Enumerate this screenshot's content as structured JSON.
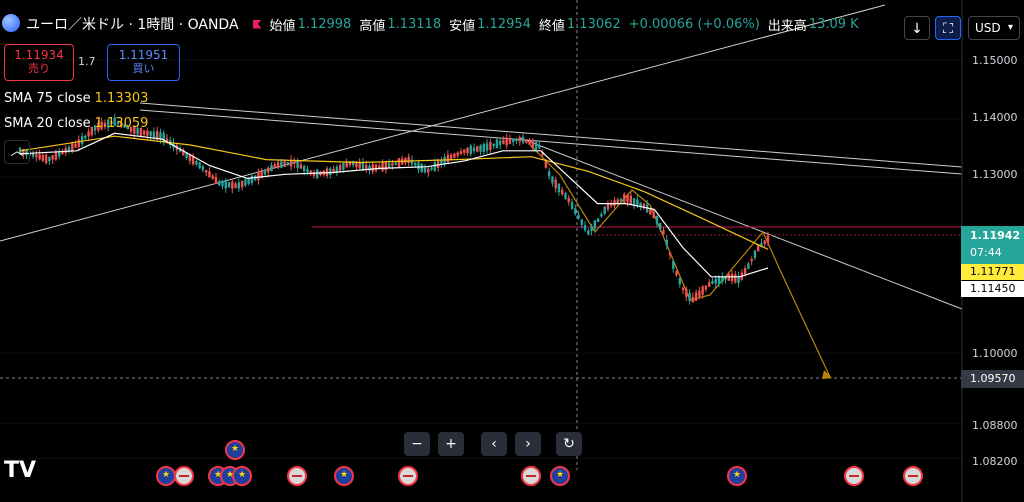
{
  "header": {
    "symbol": "ユーロ／米ドル · 1時間 · OANDA",
    "open_label": "始値",
    "open": "1.12998",
    "high_label": "高値",
    "high": "1.13118",
    "low_label": "安値",
    "low": "1.12954",
    "close_label": "終値",
    "close": "1.13062",
    "change": "+0.00066 (+0.06%)",
    "volume_label": "出来高",
    "volume": "13.09 K"
  },
  "trade": {
    "sell_price": "1.11934",
    "sell_label": "売り",
    "spread": "1.7",
    "buy_price": "1.11951",
    "buy_label": "買い"
  },
  "indicators": [
    {
      "name": "SMA 75 close",
      "value": "1.13303",
      "color": "#f5c518"
    },
    {
      "name": "SMA 20 close",
      "value": "1.13059",
      "color": "#ffffff"
    }
  ],
  "toolbar": {
    "currency": "USD",
    "download_icon": "arrow-down-icon",
    "fullscreen_icon": "expand-icon"
  },
  "price_tags": {
    "last": "1.11942",
    "countdown": "07:44",
    "sma75": "1.11771",
    "sma20": "1.11450",
    "crosshair": "1.09570"
  },
  "navigation": [
    "zoom-out-icon",
    "zoom-in-icon",
    "scroll-left-icon",
    "scroll-right-icon",
    "reset-icon"
  ],
  "chart_data": {
    "type": "line",
    "y_axis_ticks": [
      "1.15000",
      "1.14000",
      "1.13000",
      "1.10000",
      "1.08800",
      "1.08200"
    ],
    "ylim": [
      1.078,
      1.158
    ],
    "candle_trend": [
      [
        0,
        1.1345
      ],
      [
        3,
        1.133
      ],
      [
        6,
        1.1355
      ],
      [
        8,
        1.1385
      ],
      [
        10,
        1.1395
      ],
      [
        12,
        1.138
      ],
      [
        15,
        1.137
      ],
      [
        17,
        1.1345
      ],
      [
        19,
        1.132
      ],
      [
        21,
        1.129
      ],
      [
        23,
        1.1285
      ],
      [
        25,
        1.13
      ],
      [
        27,
        1.132
      ],
      [
        29,
        1.1325
      ],
      [
        31,
        1.1305
      ],
      [
        33,
        1.131
      ],
      [
        35,
        1.1325
      ],
      [
        37,
        1.1315
      ],
      [
        39,
        1.132
      ],
      [
        41,
        1.133
      ],
      [
        43,
        1.131
      ],
      [
        45,
        1.133
      ],
      [
        47,
        1.1345
      ],
      [
        49,
        1.135
      ],
      [
        51,
        1.136
      ],
      [
        53,
        1.1365
      ],
      [
        55,
        1.135
      ],
      [
        56,
        1.13
      ],
      [
        58,
        1.126
      ],
      [
        60,
        1.1205
      ],
      [
        61,
        1.1225
      ],
      [
        62,
        1.125
      ],
      [
        64,
        1.1265
      ],
      [
        66,
        1.125
      ],
      [
        67,
        1.1235
      ],
      [
        68,
        1.1205
      ],
      [
        69,
        1.115
      ],
      [
        70,
        1.111
      ],
      [
        71,
        1.109
      ],
      [
        72,
        1.1105
      ],
      [
        73,
        1.112
      ],
      [
        75,
        1.113
      ],
      [
        76,
        1.1125
      ],
      [
        77,
        1.115
      ],
      [
        78,
        1.118
      ],
      [
        79,
        1.1194
      ]
    ],
    "sma20": [
      [
        0,
        1.134
      ],
      [
        6,
        1.1345
      ],
      [
        10,
        1.1375
      ],
      [
        15,
        1.1365
      ],
      [
        20,
        1.132
      ],
      [
        24,
        1.1298
      ],
      [
        28,
        1.1305
      ],
      [
        33,
        1.1308
      ],
      [
        38,
        1.1315
      ],
      [
        43,
        1.1318
      ],
      [
        47,
        1.1328
      ],
      [
        51,
        1.1345
      ],
      [
        55,
        1.1345
      ],
      [
        58,
        1.13
      ],
      [
        61,
        1.1255
      ],
      [
        64,
        1.1255
      ],
      [
        67,
        1.1245
      ],
      [
        70,
        1.118
      ],
      [
        73,
        1.113
      ],
      [
        76,
        1.113
      ],
      [
        79,
        1.1145
      ]
    ],
    "sma75": [
      [
        0,
        1.1345
      ],
      [
        10,
        1.137
      ],
      [
        18,
        1.1355
      ],
      [
        26,
        1.133
      ],
      [
        36,
        1.1325
      ],
      [
        46,
        1.133
      ],
      [
        54,
        1.1335
      ],
      [
        60,
        1.131
      ],
      [
        66,
        1.1275
      ],
      [
        72,
        1.123
      ],
      [
        79,
        1.1177
      ]
    ]
  }
}
